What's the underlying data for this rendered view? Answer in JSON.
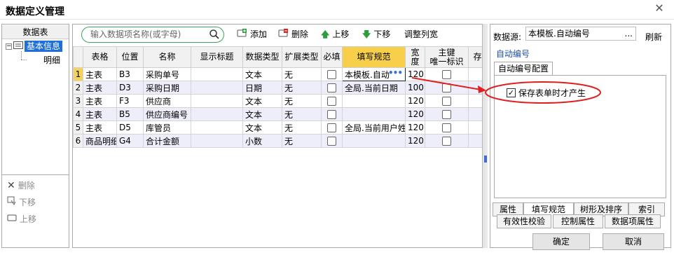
{
  "window": {
    "title": "数据定义管理"
  },
  "left": {
    "header": "数据表",
    "tree_root": "基本信息",
    "tree_child": "明细",
    "actions": {
      "delete": "删除",
      "move_down": "下移",
      "move_up": "上移"
    }
  },
  "toolbar": {
    "search_placeholder": "输入数据项名称(或字母)",
    "add": "添加",
    "delete": "删除",
    "move_up": "上移",
    "move_down": "下移",
    "adjust_width": "调整列宽"
  },
  "table": {
    "headers": [
      "表格",
      "位置",
      "名称",
      "显示标题",
      "数据类型",
      "扩展类型",
      "必填",
      "填写规范",
      "宽度",
      "主键",
      "唯一标识",
      "存"
    ],
    "rows": [
      {
        "n": "1",
        "table": "主表",
        "pos": "B3",
        "name": "采购单号",
        "disp": "",
        "dtype": "文本",
        "ext": "无",
        "rule": "本模板.自动",
        "width": "120"
      },
      {
        "n": "2",
        "table": "主表",
        "pos": "D3",
        "name": "采购日期",
        "disp": "",
        "dtype": "日期",
        "ext": "无",
        "rule": "全局.当前日期",
        "width": "100"
      },
      {
        "n": "3",
        "table": "主表",
        "pos": "F3",
        "name": "供应商",
        "disp": "",
        "dtype": "文本",
        "ext": "无",
        "rule": "",
        "width": "120"
      },
      {
        "n": "4",
        "table": "主表",
        "pos": "B5",
        "name": "供应商编号",
        "disp": "",
        "dtype": "文本",
        "ext": "无",
        "rule": "",
        "width": "120"
      },
      {
        "n": "5",
        "table": "主表",
        "pos": "D5",
        "name": "库管员",
        "disp": "",
        "dtype": "文本",
        "ext": "无",
        "rule": "全局.当前用户姓",
        "width": "120"
      },
      {
        "n": "6",
        "table": "商品明细",
        "pos": "G4",
        "name": "合计金额",
        "disp": "",
        "dtype": "小数",
        "ext": "无",
        "rule": "",
        "width": "120"
      }
    ],
    "ellipsis": "•••"
  },
  "right": {
    "source_label": "数据源:",
    "source_value": "本模板.自动编号",
    "source_dots": "...",
    "refresh": "刷新",
    "section_title": "自动编号",
    "config_tab": "自动编号配置",
    "checkbox_label": "保存表单时才产生",
    "tabs_row1": [
      "属性",
      "填写规范",
      "树形及排序",
      "索引"
    ],
    "tabs_row2": [
      "有效性校验",
      "控制属性",
      "数据项属性"
    ]
  },
  "footer": {
    "ok": "确定",
    "cancel": "取消"
  },
  "colors": {
    "accent": "#1e6fd9",
    "highlight": "#f7cf4b",
    "annotation": "#e02020",
    "search_border": "#3aa55d"
  }
}
